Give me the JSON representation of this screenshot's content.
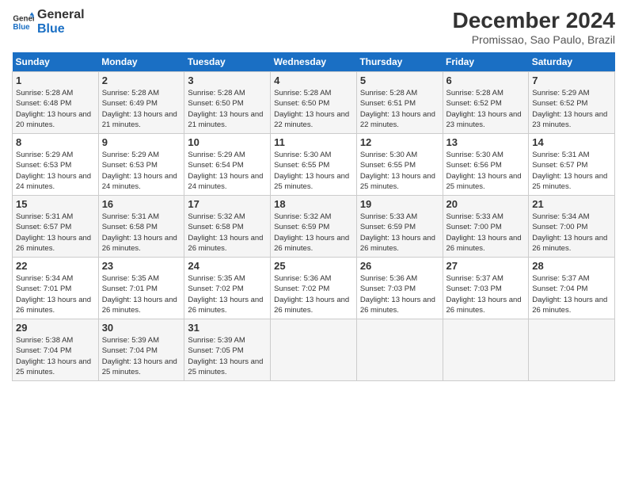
{
  "logo": {
    "line1": "General",
    "line2": "Blue"
  },
  "title": "December 2024",
  "subtitle": "Promissao, Sao Paulo, Brazil",
  "days_header": [
    "Sunday",
    "Monday",
    "Tuesday",
    "Wednesday",
    "Thursday",
    "Friday",
    "Saturday"
  ],
  "weeks": [
    [
      {
        "day": "1",
        "sunrise": "Sunrise: 5:28 AM",
        "sunset": "Sunset: 6:48 PM",
        "daylight": "Daylight: 13 hours and 20 minutes."
      },
      {
        "day": "2",
        "sunrise": "Sunrise: 5:28 AM",
        "sunset": "Sunset: 6:49 PM",
        "daylight": "Daylight: 13 hours and 21 minutes."
      },
      {
        "day": "3",
        "sunrise": "Sunrise: 5:28 AM",
        "sunset": "Sunset: 6:50 PM",
        "daylight": "Daylight: 13 hours and 21 minutes."
      },
      {
        "day": "4",
        "sunrise": "Sunrise: 5:28 AM",
        "sunset": "Sunset: 6:50 PM",
        "daylight": "Daylight: 13 hours and 22 minutes."
      },
      {
        "day": "5",
        "sunrise": "Sunrise: 5:28 AM",
        "sunset": "Sunset: 6:51 PM",
        "daylight": "Daylight: 13 hours and 22 minutes."
      },
      {
        "day": "6",
        "sunrise": "Sunrise: 5:28 AM",
        "sunset": "Sunset: 6:52 PM",
        "daylight": "Daylight: 13 hours and 23 minutes."
      },
      {
        "day": "7",
        "sunrise": "Sunrise: 5:29 AM",
        "sunset": "Sunset: 6:52 PM",
        "daylight": "Daylight: 13 hours and 23 minutes."
      }
    ],
    [
      {
        "day": "8",
        "sunrise": "Sunrise: 5:29 AM",
        "sunset": "Sunset: 6:53 PM",
        "daylight": "Daylight: 13 hours and 24 minutes."
      },
      {
        "day": "9",
        "sunrise": "Sunrise: 5:29 AM",
        "sunset": "Sunset: 6:53 PM",
        "daylight": "Daylight: 13 hours and 24 minutes."
      },
      {
        "day": "10",
        "sunrise": "Sunrise: 5:29 AM",
        "sunset": "Sunset: 6:54 PM",
        "daylight": "Daylight: 13 hours and 24 minutes."
      },
      {
        "day": "11",
        "sunrise": "Sunrise: 5:30 AM",
        "sunset": "Sunset: 6:55 PM",
        "daylight": "Daylight: 13 hours and 25 minutes."
      },
      {
        "day": "12",
        "sunrise": "Sunrise: 5:30 AM",
        "sunset": "Sunset: 6:55 PM",
        "daylight": "Daylight: 13 hours and 25 minutes."
      },
      {
        "day": "13",
        "sunrise": "Sunrise: 5:30 AM",
        "sunset": "Sunset: 6:56 PM",
        "daylight": "Daylight: 13 hours and 25 minutes."
      },
      {
        "day": "14",
        "sunrise": "Sunrise: 5:31 AM",
        "sunset": "Sunset: 6:57 PM",
        "daylight": "Daylight: 13 hours and 25 minutes."
      }
    ],
    [
      {
        "day": "15",
        "sunrise": "Sunrise: 5:31 AM",
        "sunset": "Sunset: 6:57 PM",
        "daylight": "Daylight: 13 hours and 26 minutes."
      },
      {
        "day": "16",
        "sunrise": "Sunrise: 5:31 AM",
        "sunset": "Sunset: 6:58 PM",
        "daylight": "Daylight: 13 hours and 26 minutes."
      },
      {
        "day": "17",
        "sunrise": "Sunrise: 5:32 AM",
        "sunset": "Sunset: 6:58 PM",
        "daylight": "Daylight: 13 hours and 26 minutes."
      },
      {
        "day": "18",
        "sunrise": "Sunrise: 5:32 AM",
        "sunset": "Sunset: 6:59 PM",
        "daylight": "Daylight: 13 hours and 26 minutes."
      },
      {
        "day": "19",
        "sunrise": "Sunrise: 5:33 AM",
        "sunset": "Sunset: 6:59 PM",
        "daylight": "Daylight: 13 hours and 26 minutes."
      },
      {
        "day": "20",
        "sunrise": "Sunrise: 5:33 AM",
        "sunset": "Sunset: 7:00 PM",
        "daylight": "Daylight: 13 hours and 26 minutes."
      },
      {
        "day": "21",
        "sunrise": "Sunrise: 5:34 AM",
        "sunset": "Sunset: 7:00 PM",
        "daylight": "Daylight: 13 hours and 26 minutes."
      }
    ],
    [
      {
        "day": "22",
        "sunrise": "Sunrise: 5:34 AM",
        "sunset": "Sunset: 7:01 PM",
        "daylight": "Daylight: 13 hours and 26 minutes."
      },
      {
        "day": "23",
        "sunrise": "Sunrise: 5:35 AM",
        "sunset": "Sunset: 7:01 PM",
        "daylight": "Daylight: 13 hours and 26 minutes."
      },
      {
        "day": "24",
        "sunrise": "Sunrise: 5:35 AM",
        "sunset": "Sunset: 7:02 PM",
        "daylight": "Daylight: 13 hours and 26 minutes."
      },
      {
        "day": "25",
        "sunrise": "Sunrise: 5:36 AM",
        "sunset": "Sunset: 7:02 PM",
        "daylight": "Daylight: 13 hours and 26 minutes."
      },
      {
        "day": "26",
        "sunrise": "Sunrise: 5:36 AM",
        "sunset": "Sunset: 7:03 PM",
        "daylight": "Daylight: 13 hours and 26 minutes."
      },
      {
        "day": "27",
        "sunrise": "Sunrise: 5:37 AM",
        "sunset": "Sunset: 7:03 PM",
        "daylight": "Daylight: 13 hours and 26 minutes."
      },
      {
        "day": "28",
        "sunrise": "Sunrise: 5:37 AM",
        "sunset": "Sunset: 7:04 PM",
        "daylight": "Daylight: 13 hours and 26 minutes."
      }
    ],
    [
      {
        "day": "29",
        "sunrise": "Sunrise: 5:38 AM",
        "sunset": "Sunset: 7:04 PM",
        "daylight": "Daylight: 13 hours and 25 minutes."
      },
      {
        "day": "30",
        "sunrise": "Sunrise: 5:39 AM",
        "sunset": "Sunset: 7:04 PM",
        "daylight": "Daylight: 13 hours and 25 minutes."
      },
      {
        "day": "31",
        "sunrise": "Sunrise: 5:39 AM",
        "sunset": "Sunset: 7:05 PM",
        "daylight": "Daylight: 13 hours and 25 minutes."
      },
      null,
      null,
      null,
      null
    ]
  ]
}
